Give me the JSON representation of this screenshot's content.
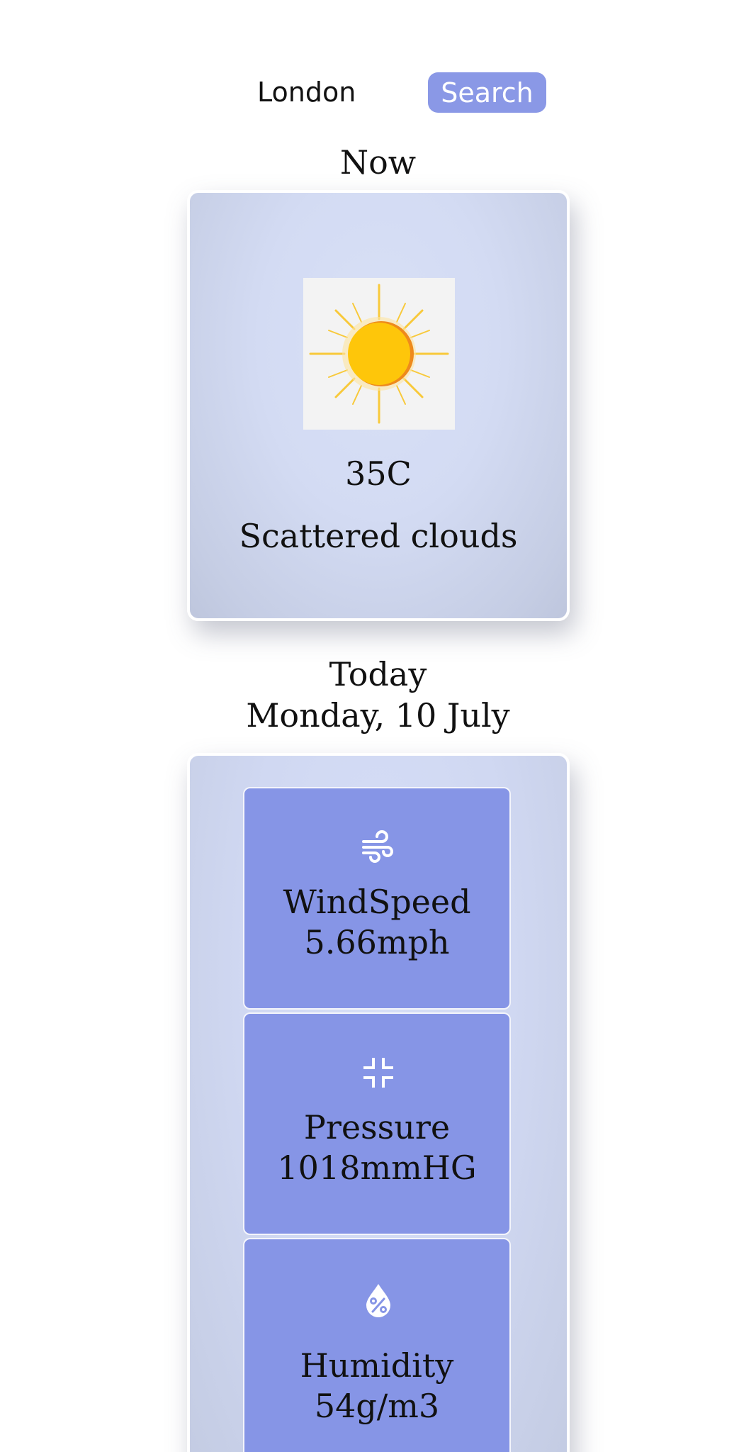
{
  "search": {
    "value": "London",
    "button_label": "Search"
  },
  "now": {
    "heading": "Now",
    "icon": "sun-icon",
    "temperature": "35C",
    "description": "Scattered clouds"
  },
  "today": {
    "heading": "Today",
    "date": "Monday, 10 July",
    "details": [
      {
        "icon": "wind-icon",
        "label": "WindSpeed",
        "value": "5.66mph"
      },
      {
        "icon": "pressure-icon",
        "label": "Pressure",
        "value": "1018mmHG"
      },
      {
        "icon": "humidity-icon",
        "label": "Humidity",
        "value": "54g/m3"
      }
    ]
  },
  "colors": {
    "accent": "#8a98e6",
    "tile": "#8695e6",
    "card": "#d3dbf3"
  }
}
